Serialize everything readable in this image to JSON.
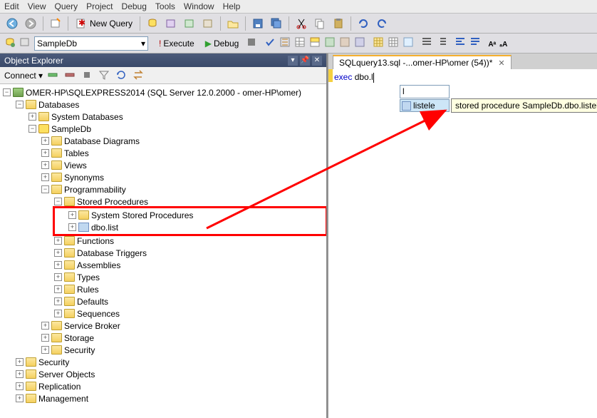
{
  "menubar": {
    "items": [
      "Edit",
      "View",
      "Query",
      "Project",
      "Debug",
      "Tools",
      "Window",
      "Help"
    ]
  },
  "toolbar1": {
    "newquery_label": "New Query"
  },
  "toolbar2": {
    "db_selected": "SampleDb",
    "execute_label": "Execute",
    "debug_label": "Debug"
  },
  "objectexplorer": {
    "title": "Object Explorer",
    "connect_label": "Connect",
    "server_label": "OMER-HP\\SQLEXPRESS2014 (SQL Server 12.0.2000 - omer-HP\\omer)",
    "nodes": {
      "databases": "Databases",
      "sysdb": "System Databases",
      "sampledb": "SampleDb",
      "dbdiagrams": "Database Diagrams",
      "tables": "Tables",
      "views": "Views",
      "synonyms": "Synonyms",
      "programmability": "Programmability",
      "storedproc": "Stored Procedures",
      "sysstoredproc": "System Stored Procedures",
      "dbolist": "dbo.list",
      "functions": "Functions",
      "dbtriggers": "Database Triggers",
      "assemblies": "Assemblies",
      "types": "Types",
      "rules": "Rules",
      "defaults": "Defaults",
      "sequences": "Sequences",
      "servicebroker": "Service Broker",
      "storage": "Storage",
      "security_inner": "Security",
      "security": "Security",
      "serverobjects": "Server Objects",
      "replication": "Replication",
      "management": "Management"
    }
  },
  "editor": {
    "tab_label": "SQLquery13.sql -...omer-HP\\omer (54))*",
    "code_kw": "exec",
    "code_rest": " dbo.l",
    "intelli_input": "l",
    "intelli_item": "listele",
    "tooltip": "stored procedure SampleDb.dbo.listele"
  }
}
